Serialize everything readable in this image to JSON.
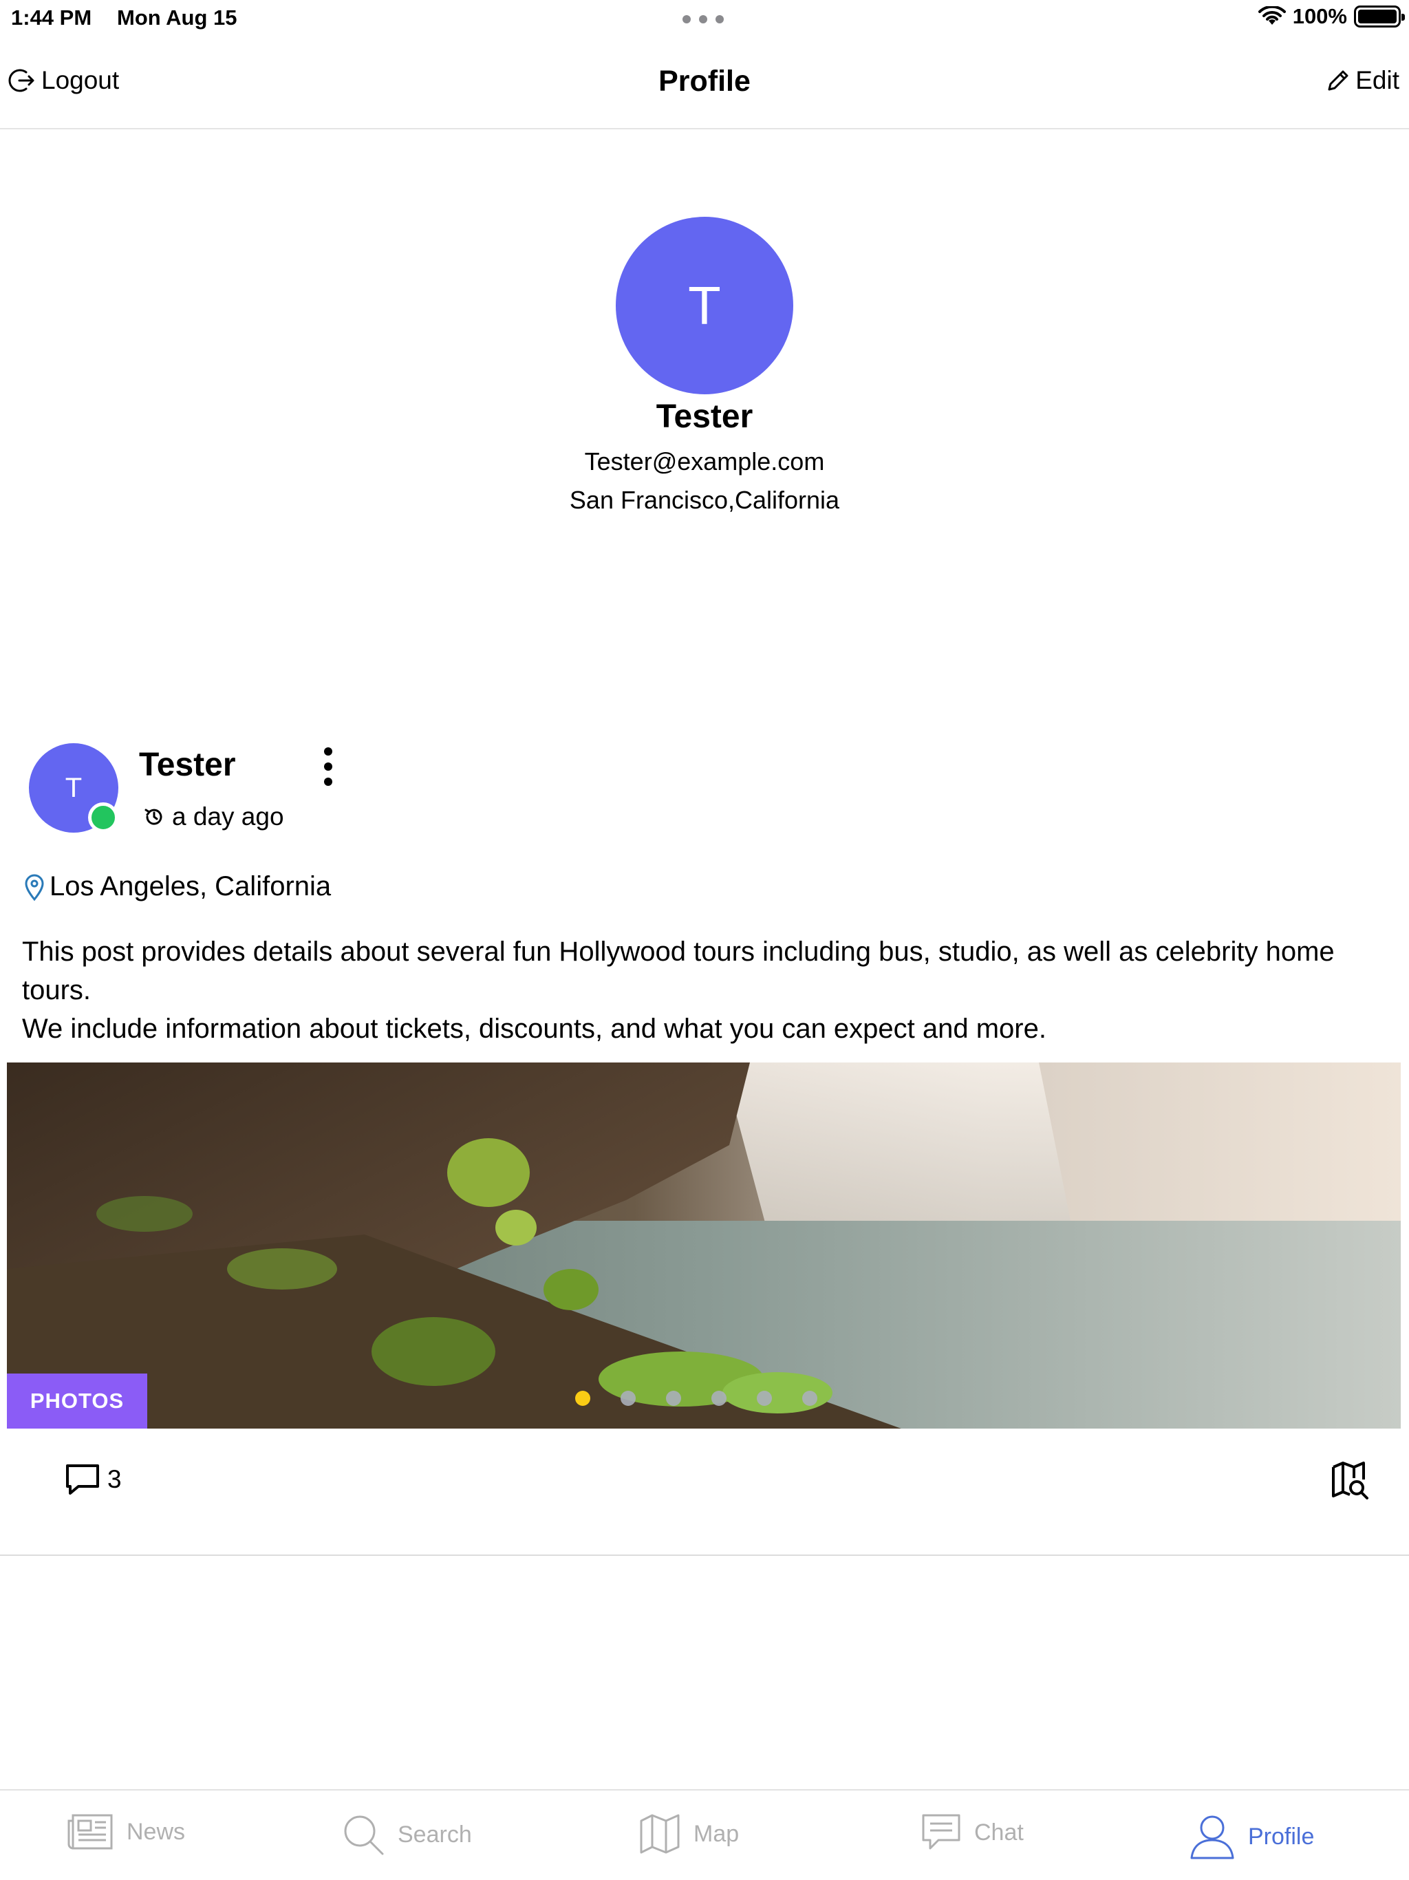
{
  "status_bar": {
    "time": "1:44 PM",
    "date": "Mon Aug 15",
    "battery": "100%"
  },
  "nav": {
    "logout_label": "Logout",
    "title": "Profile",
    "edit_label": "Edit"
  },
  "profile": {
    "avatar_initial": "T",
    "name": "Tester",
    "email": "Tester@example.com",
    "location": "San Francisco,California"
  },
  "post": {
    "avatar_initial": "T",
    "author": "Tester",
    "time": "a day ago",
    "location": "Los Angeles, California",
    "body_line1": "This post provides details about several fun Hollywood tours including bus, studio, as well as celebrity home tours.",
    "body_line2": "We include information about tickets, discounts, and what you can expect and more.",
    "badge": "PHOTOS",
    "carousel_total": 6,
    "carousel_active": 1,
    "comment_count": "3"
  },
  "tabs": [
    {
      "label": "News",
      "icon": "newspaper-icon",
      "active": false
    },
    {
      "label": "Search",
      "icon": "search-icon",
      "active": false
    },
    {
      "label": "Map",
      "icon": "map-icon",
      "active": false
    },
    {
      "label": "Chat",
      "icon": "chat-icon",
      "active": false
    },
    {
      "label": "Profile",
      "icon": "user-icon",
      "active": true
    }
  ],
  "colors": {
    "avatar": "#6366f1",
    "online": "#22c55e",
    "badge": "#8b5cf6",
    "carousel_active": "#facc15",
    "tab_active": "#4a6fd8",
    "tab_inactive": "#b0b0b0"
  }
}
